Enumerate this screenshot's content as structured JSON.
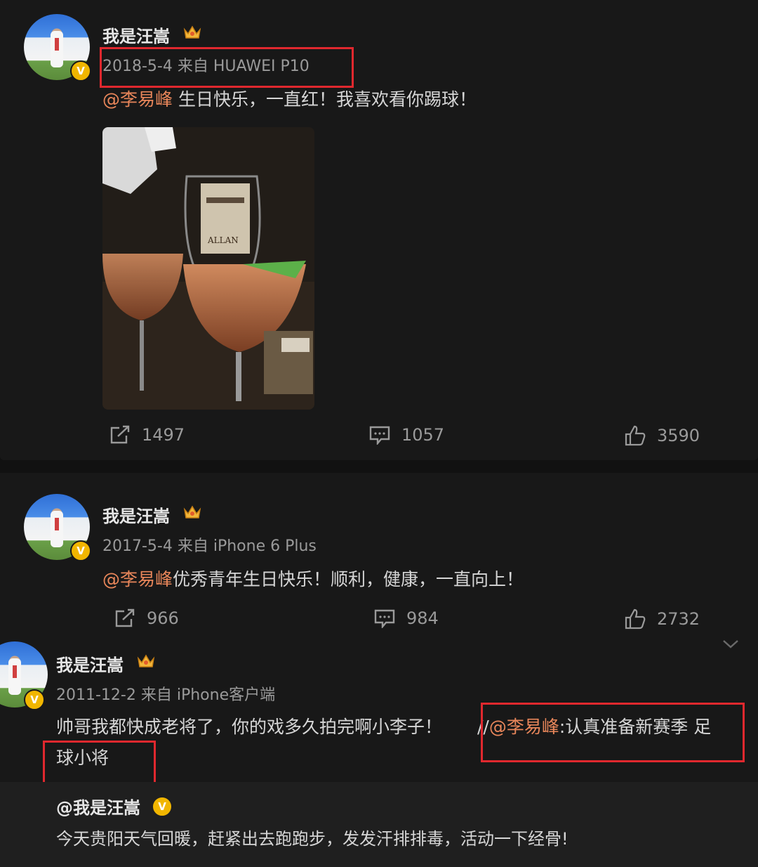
{
  "posts": [
    {
      "author": "我是汪嵩",
      "meta": "2018-5-4 来自 HUAWEI P10",
      "mention": "@李易峰",
      "text": " 生日快乐，一直红！我喜欢看你踢球！",
      "repost_count": "1497",
      "comment_count": "1057",
      "like_count": "3590"
    },
    {
      "author": "我是汪嵩",
      "meta": "2017-5-4 来自 iPhone 6 Plus",
      "mention": "@李易峰",
      "text": "优秀青年生日快乐！顺利，健康，一直向上！",
      "repost_count": "966",
      "comment_count": "984",
      "like_count": "2732"
    },
    {
      "author": "我是汪嵩",
      "meta": "2011-12-2 来自 iPhone客户端",
      "text_part1": "帅哥我都快成老将了，你的戏多久拍完啊小李子！",
      "text_slashes": "//",
      "mention": "@李易峰",
      "text_part2": ":认真准备新赛季 足",
      "text_part3": "球小将"
    }
  ],
  "quoted": {
    "author": "@我是汪嵩",
    "text": "今天贵阳天气回暖，赶紧出去跑跑步，发发汗排排毒，活动一下经骨!"
  },
  "photo_label": "ALLAN",
  "colors": {
    "mention": "#e8865a",
    "highlight_box": "#e0282e",
    "verified_badge": "#f1b600"
  },
  "icons": [
    "repost-icon",
    "comment-icon",
    "like-icon",
    "crown-icon",
    "verified-icon",
    "chevron-down-icon"
  ]
}
